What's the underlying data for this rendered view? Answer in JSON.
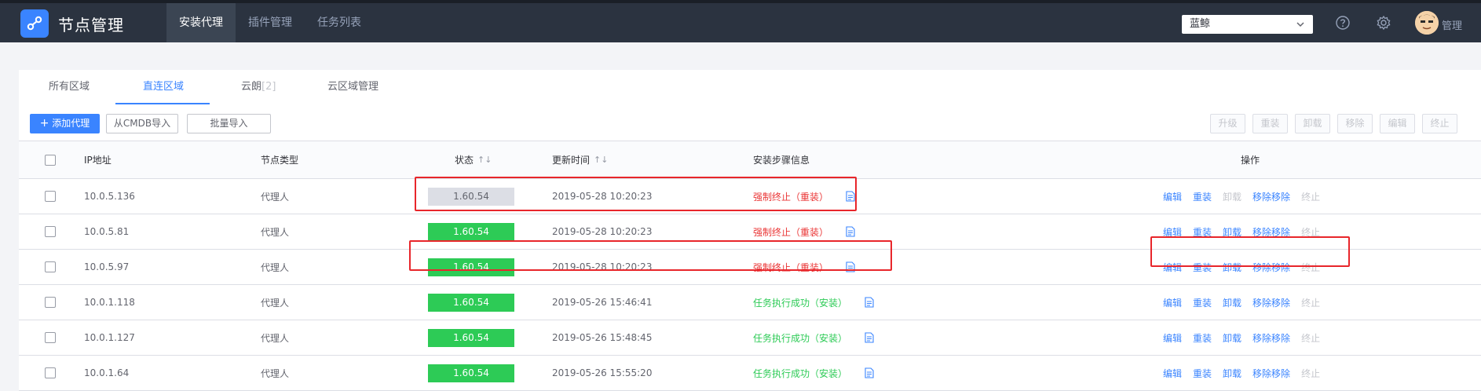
{
  "header": {
    "app_title": "节点管理",
    "nav": [
      "安装代理",
      "插件管理",
      "任务列表"
    ],
    "business": "蓝鲸",
    "user": "管理"
  },
  "tabs": [
    {
      "label": "所有区域"
    },
    {
      "label": "直连区域"
    },
    {
      "label": "云朗",
      "count": "[2]"
    },
    {
      "label": "云区域管理"
    }
  ],
  "toolbar": {
    "add": "添加代理",
    "cmdb": "从CMDB导入",
    "batch": "批量导入",
    "bulk_actions": [
      "升级",
      "重装",
      "卸载",
      "移除",
      "编辑",
      "终止"
    ]
  },
  "table": {
    "headers": {
      "ip": "IP地址",
      "type": "节点类型",
      "status": "状态",
      "updated": "更新时间",
      "info": "安装步骤信息",
      "ops": "操作"
    },
    "rows": [
      {
        "ip": "10.0.5.136",
        "type": "代理人",
        "version": "1.60.54",
        "status_color": "gray",
        "time": "2019-05-28 10:20:23",
        "info": "强制终止（重装）",
        "info_state": "fail",
        "ops": [
          "编辑",
          "重装",
          "卸载",
          "移除移除",
          "终止"
        ],
        "disabled": [
          2,
          4
        ]
      },
      {
        "ip": "10.0.5.81",
        "type": "代理人",
        "version": "1.60.54",
        "status_color": "green",
        "time": "2019-05-28 10:20:23",
        "info": "强制终止（重装）",
        "info_state": "fail",
        "ops": [
          "编辑",
          "重装",
          "卸载",
          "移除移除",
          "终止"
        ],
        "disabled": [
          4
        ]
      },
      {
        "ip": "10.0.5.97",
        "type": "代理人",
        "version": "1.60.54",
        "status_color": "green",
        "time": "2019-05-28 10:20:23",
        "info": "强制终止（重装）",
        "info_state": "fail",
        "ops": [
          "编辑",
          "重装",
          "卸载",
          "移除移除",
          "终止"
        ],
        "disabled": [
          4
        ]
      },
      {
        "ip": "10.0.1.118",
        "type": "代理人",
        "version": "1.60.54",
        "status_color": "green",
        "time": "2019-05-26 15:46:41",
        "info": "任务执行成功（安装）",
        "info_state": "ok",
        "ops": [
          "编辑",
          "重装",
          "卸载",
          "移除移除",
          "终止"
        ],
        "disabled": [
          4
        ]
      },
      {
        "ip": "10.0.1.127",
        "type": "代理人",
        "version": "1.60.54",
        "status_color": "green",
        "time": "2019-05-26 15:48:45",
        "info": "任务执行成功（安装）",
        "info_state": "ok",
        "ops": [
          "编辑",
          "重装",
          "卸载",
          "移除移除",
          "终止"
        ],
        "disabled": [
          4
        ]
      },
      {
        "ip": "10.0.1.64",
        "type": "代理人",
        "version": "1.60.54",
        "status_color": "green",
        "time": "2019-05-26 15:55:20",
        "info": "任务执行成功（安装）",
        "info_state": "ok",
        "ops": [
          "编辑",
          "重装",
          "卸载",
          "移除移除",
          "终止"
        ],
        "disabled": [
          4
        ]
      }
    ]
  },
  "colors": {
    "accent": "#3a84ff",
    "success": "#2dcb56",
    "danger": "#ea3636",
    "highlight": "#e8262b"
  }
}
